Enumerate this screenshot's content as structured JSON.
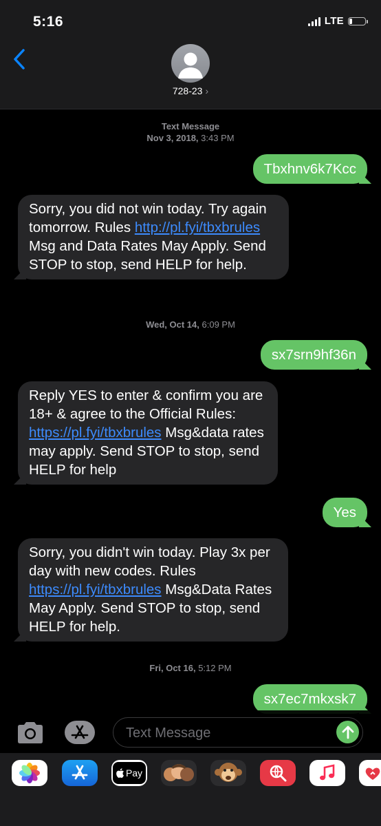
{
  "status_bar": {
    "time": "5:16",
    "network": "LTE",
    "battery_level": 0.2
  },
  "header": {
    "back_icon": "chevron-left-icon",
    "avatar_icon": "person-silhouette-icon",
    "contact_name": "728-23",
    "contact_chevron": "›"
  },
  "conversation": {
    "timestamps": [
      {
        "label": "Text Message",
        "date": "Nov 3, 2018,",
        "time": "3:43 PM"
      },
      {
        "label": "",
        "date": "Wed, Oct 14,",
        "time": "6:09 PM"
      },
      {
        "label": "",
        "date": "Fri, Oct 16,",
        "time": "5:12 PM"
      }
    ],
    "messages": [
      {
        "direction": "sent",
        "text": "Tbxhnv6k7Kcc"
      },
      {
        "direction": "received",
        "parts": [
          "Sorry, you did not win today. Try again tomorrow. Rules ",
          "http://pl.fyi/tbxbrules",
          " Msg and Data Rates May Apply. Send STOP to stop, send HELP for help."
        ]
      },
      {
        "direction": "sent",
        "text": "sx7srn9hf36n"
      },
      {
        "direction": "received",
        "parts": [
          "Reply YES to enter & confirm you are 18+ & agree to the Official Rules: ",
          "https://pl.fyi/tbxbrules",
          " Msg&data rates may apply. Send STOP to stop, send HELP for help"
        ]
      },
      {
        "direction": "sent",
        "text": "Yes"
      },
      {
        "direction": "received",
        "parts": [
          "Sorry, you didn't win today. Play 3x per day with new codes. Rules ",
          "https://pl.fyi/tbxbrules",
          " Msg&Data Rates May Apply. Send STOP to stop, send HELP for help."
        ]
      },
      {
        "direction": "sent",
        "text": "sx7ec7mkxsk7"
      }
    ]
  },
  "composer": {
    "camera_icon": "camera-icon",
    "apps_icon": "app-store-icon",
    "placeholder": "Text Message",
    "value": "",
    "send_icon": "arrow-up-icon"
  },
  "app_drawer": {
    "apps": [
      {
        "name": "photos-icon"
      },
      {
        "name": "app-store-icon"
      },
      {
        "name": "apple-pay-icon",
        "label": "Pay"
      },
      {
        "name": "memoji-icon"
      },
      {
        "name": "animoji-monkey-icon"
      },
      {
        "name": "web-search-icon"
      },
      {
        "name": "music-icon"
      },
      {
        "name": "digital-touch-icon"
      }
    ]
  },
  "colors": {
    "sent_bubble": "#65c466",
    "received_bubble": "#262628",
    "link": "#3d8bfd",
    "accent_blue": "#0a84ff"
  }
}
